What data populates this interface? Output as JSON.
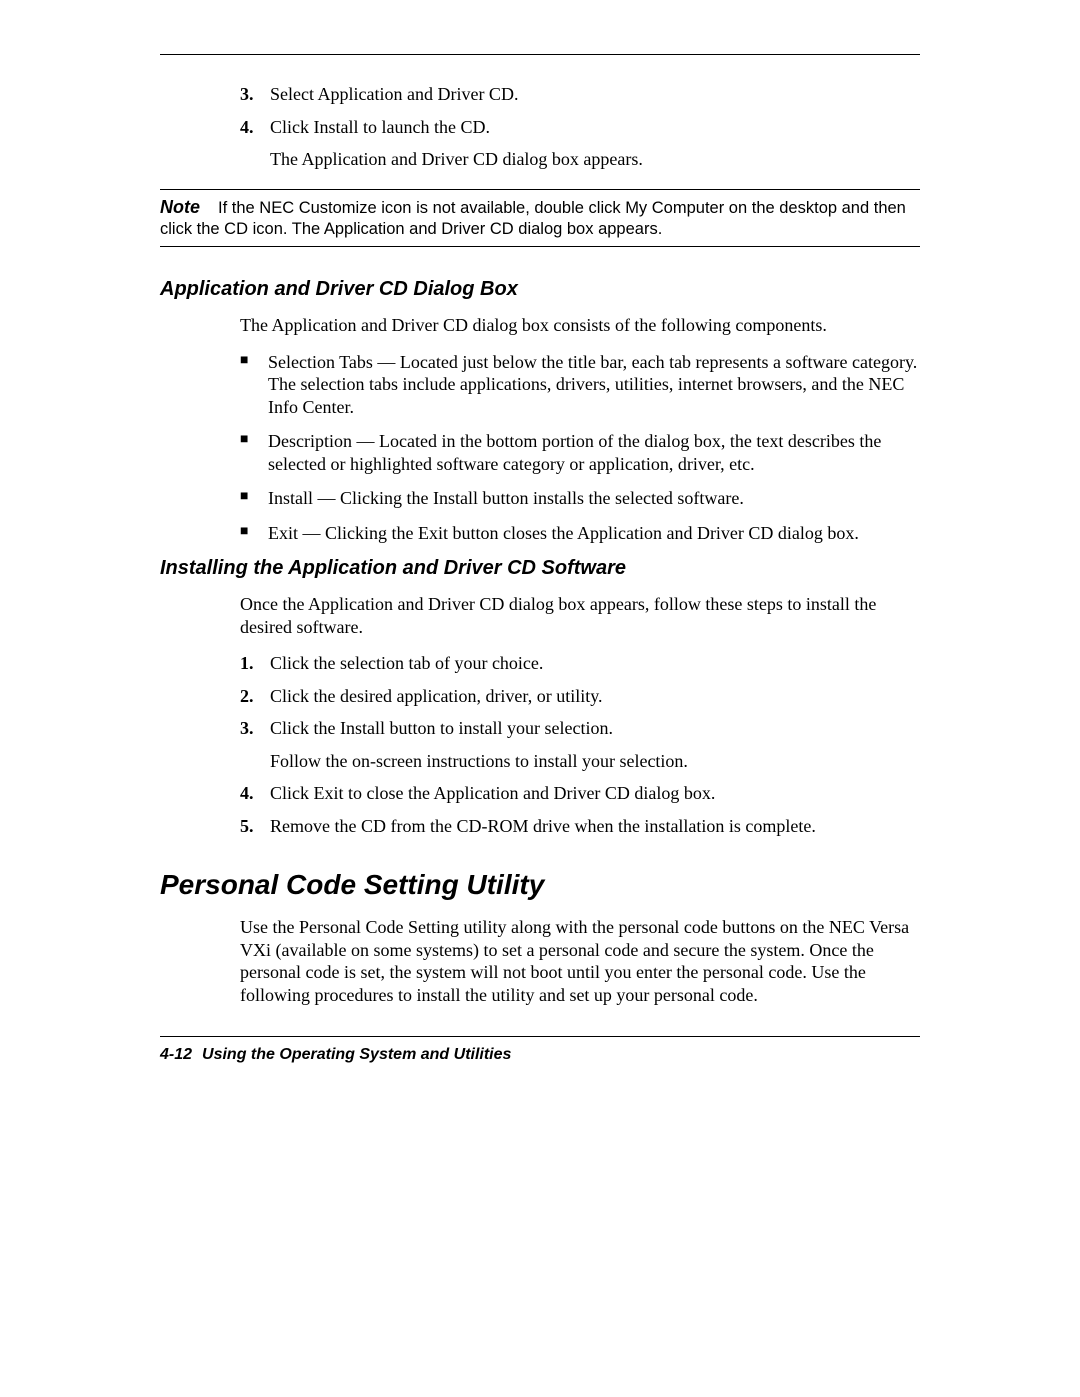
{
  "steps_top": [
    {
      "num": "3.",
      "text": "Select Application and Driver CD."
    },
    {
      "num": "4.",
      "text": "Click Install to launch the CD.",
      "follow": "The Application and Driver CD dialog box appears."
    }
  ],
  "note": {
    "label": "Note",
    "text": "If the NEC Customize icon is not available, double click My Computer on the desktop and then click the CD icon. The Application and Driver CD dialog box appears."
  },
  "section1": {
    "heading": "Application and Driver CD Dialog Box",
    "intro": "The Application and Driver CD dialog box consists of the following components.",
    "bullets": [
      "Selection Tabs — Located just below the title bar, each tab represents a software category. The selection tabs include applications, drivers, utilities, internet browsers, and the NEC Info Center.",
      "Description — Located in the bottom portion of the dialog box, the text describes the selected or highlighted software category or application, driver, etc.",
      "Install — Clicking the Install button installs the selected software.",
      "Exit — Clicking the Exit button closes the Application and Driver CD dialog box."
    ]
  },
  "section2": {
    "heading": "Installing the Application and Driver CD Software",
    "intro": "Once the Application and Driver CD dialog box appears, follow these steps to install the desired software.",
    "steps": [
      {
        "num": "1.",
        "text": "Click the selection tab of your choice."
      },
      {
        "num": "2.",
        "text": "Click the desired application, driver, or utility."
      },
      {
        "num": "3.",
        "text": "Click the Install button to install your selection.",
        "follow": "Follow the on-screen instructions to install your selection."
      },
      {
        "num": "4.",
        "text": "Click Exit to close the Application and Driver CD dialog box."
      },
      {
        "num": "5.",
        "text": "Remove the CD from the CD-ROM drive when the installation is complete."
      }
    ]
  },
  "section3": {
    "heading": "Personal Code Setting Utility",
    "para": "Use the Personal Code Setting utility along with the personal code buttons on the NEC Versa VXi (available on some systems) to set a personal code and secure the system. Once the personal code is set, the system will not boot until you enter the personal code. Use the following procedures to install the utility and set up your personal code."
  },
  "footer": {
    "page": "4-12",
    "title": "Using the Operating System and Utilities"
  }
}
